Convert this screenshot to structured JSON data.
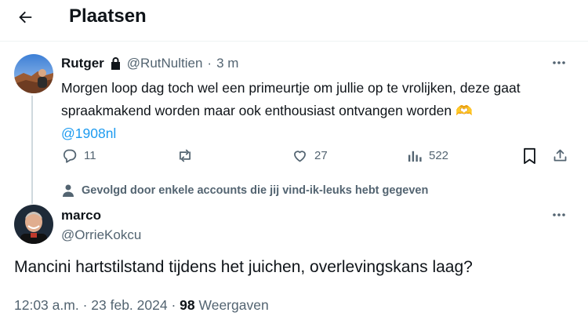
{
  "header": {
    "title": "Plaatsen"
  },
  "reply_tweet": {
    "author_name": "Rutger",
    "handle": "@RutNultien",
    "separator": "·",
    "time_ago": "3 m",
    "text": "Morgen loop dag toch wel een primeurtje om jullie op te vrolijken, deze gaat spraakmakend worden maar ook enthousiast ontvangen worden",
    "emoji": "🫶",
    "mention": "@1908nl",
    "actions": {
      "replies": "11",
      "likes": "27",
      "views": "522"
    }
  },
  "follow_note": "Gevolgd door enkele accounts die jij vind-ik-leuks hebt gegeven",
  "main_tweet": {
    "author_name": "marco",
    "handle": "@OrrieKokcu",
    "text": "Mancini hartstilstand tijdens het juichen, overlevingskans laag?",
    "time": "12:03 a.m.",
    "sep1": "·",
    "date": "23 feb. 2024",
    "sep2": "·",
    "views_count": "98",
    "views_label": "Weergaven"
  },
  "colors": {
    "accent": "#1d9bf0",
    "muted": "#536471",
    "text": "#0f1419",
    "line": "#cfd9de"
  },
  "icons": [
    "back-arrow-icon",
    "lock-icon",
    "more-icon",
    "reply-icon",
    "retweet-icon",
    "like-icon",
    "views-icon",
    "bookmark-icon",
    "share-icon",
    "person-icon"
  ]
}
